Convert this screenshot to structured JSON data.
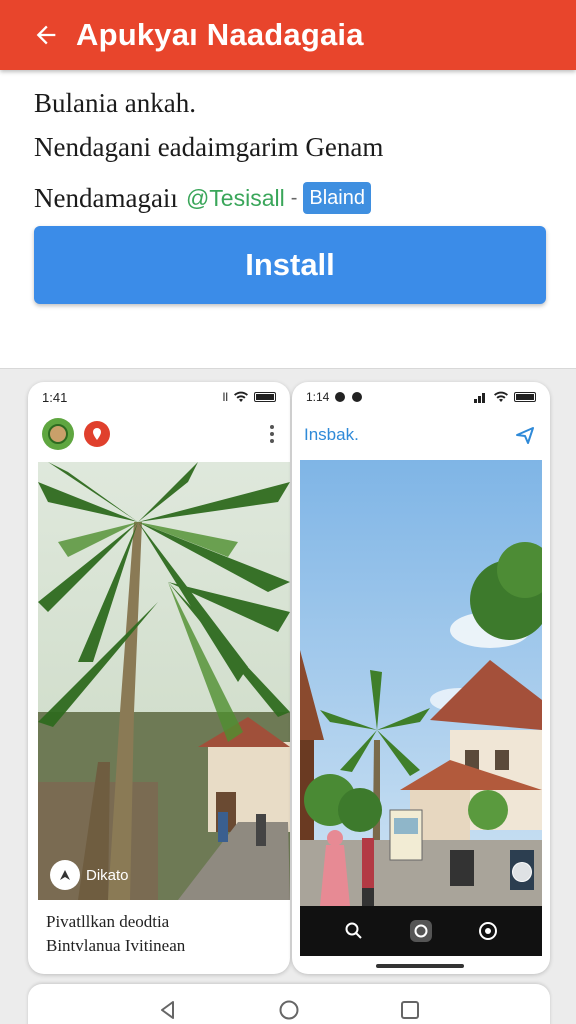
{
  "app_bar": {
    "title": "Apukyaı Naadagaia",
    "back_icon": "arrow-left-icon",
    "color": "#e8452c"
  },
  "description": {
    "line1": "Bulania ankah.",
    "line2": "Nendagani eadaimgarim Genam",
    "line3_text": "Nendamagaiı",
    "tag_green": "@Tesisall",
    "tag_separator": "-",
    "tag_blue": "Blaind"
  },
  "install_button": {
    "label": "Install",
    "color": "#3b8ce8"
  },
  "screenshots": {
    "left": {
      "status_time": "1:41",
      "status_signal": "ll",
      "overlay_label": "Dikato",
      "caption_line1": "Pivatllkan deodtia",
      "caption_line2": "Bintvlanua Ivitinean"
    },
    "right": {
      "status_time": "1:14",
      "header_title": "Insbak."
    }
  },
  "icons": {
    "status": [
      "wifi-icon",
      "battery-icon"
    ],
    "left_header": [
      "avatar-icon",
      "pin-icon",
      "more-vert-icon"
    ],
    "right_header": [
      "share-icon"
    ],
    "camera_bar": [
      "search-icon",
      "camera-icon",
      "settings-icon"
    ],
    "nav_bar": [
      "back-triangle-icon",
      "home-circle-icon",
      "recents-square-icon"
    ]
  }
}
